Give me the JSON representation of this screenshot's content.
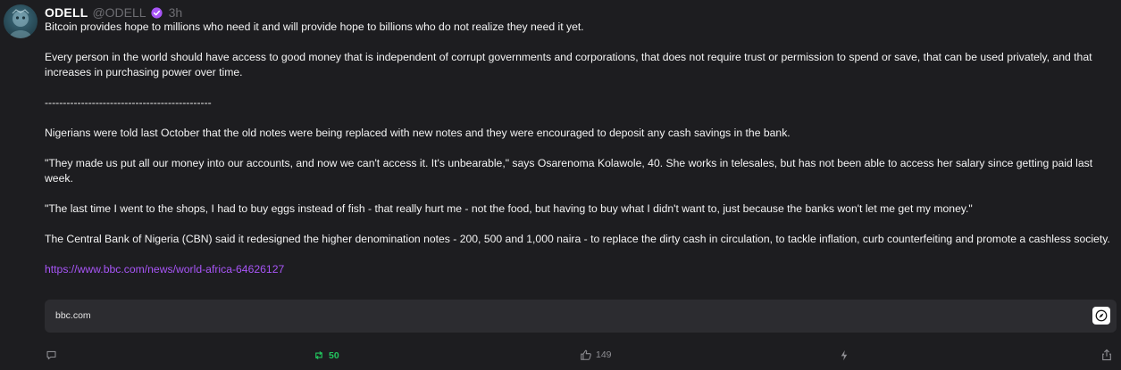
{
  "author": {
    "name": "ODELL",
    "handle": "@ODELL",
    "time": "3h",
    "verified_color": "#a855f7"
  },
  "post": {
    "paragraphs": [
      "Bitcoin provides hope to millions who need it and will provide hope to billions who do not realize they need it yet.",
      "Every person in the world should have access to good money that is independent of corrupt governments and corporations, that does not require trust or permission to spend or save, that can be used privately, and that increases in purchasing power over time.",
      "----------------------------------------------",
      "Nigerians were told last October that the old notes were being replaced with new notes and they were encouraged to deposit any cash savings in the bank.",
      "\"They made us put all our money into our accounts, and now we can't access it. It's unbearable,\" says Osarenoma Kolawole, 40. She works in telesales, but has not been able to access her salary since getting paid last week.",
      "\"The last time I went to the shops, I had to buy eggs instead of fish - that really hurt me - not the food, but having to buy what I didn't want to, just because the banks won't let me get my money.\"",
      "The Central Bank of Nigeria (CBN) said it redesigned the higher denomination notes - 200, 500 and 1,000 naira - to replace the dirty cash in circulation, to tackle inflation, curb counterfeiting and promote a cashless society."
    ],
    "link": "https://www.bbc.com/news/world-africa-64626127"
  },
  "preview": {
    "domain": "bbc.com",
    "icon": "compass-icon"
  },
  "actions": {
    "repost_count": "50",
    "like_count": "149",
    "repost_color": "#22c55e"
  }
}
